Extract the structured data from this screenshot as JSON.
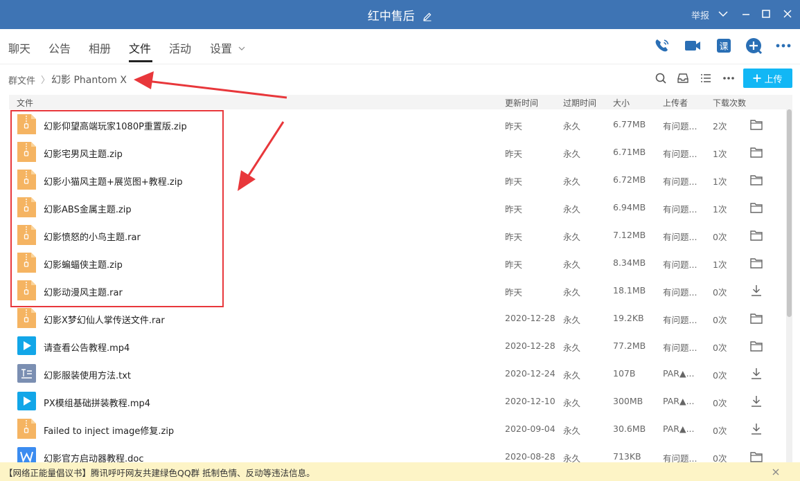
{
  "window": {
    "title": "红中售后",
    "report": "举报"
  },
  "tabs": [
    {
      "label": "聊天"
    },
    {
      "label": "公告"
    },
    {
      "label": "相册"
    },
    {
      "label": "文件"
    },
    {
      "label": "活动"
    },
    {
      "label": "设置"
    }
  ],
  "toolbar_icons": [
    "phone-icon",
    "video-icon",
    "class-icon",
    "add-icon",
    "more-icon"
  ],
  "breadcrumb": {
    "root": "群文件",
    "separator": "〉",
    "current": "幻影 Phantom X"
  },
  "upload_button": {
    "label": "上传"
  },
  "columns": {
    "file": "文件",
    "updated": "更新时间",
    "expires": "过期时间",
    "size": "大小",
    "uploader": "上传者",
    "downloads": "下载次数"
  },
  "files": [
    {
      "name": "幻影仰望高端玩家1080P重置版.zip",
      "type": "zip",
      "updated": "昨天",
      "expires": "永久",
      "size": "6.77MB",
      "uploader": "有问题...",
      "downloads": "2次",
      "action": "folder"
    },
    {
      "name": "幻影宅男风主题.zip",
      "type": "zip",
      "updated": "昨天",
      "expires": "永久",
      "size": "6.71MB",
      "uploader": "有问题...",
      "downloads": "1次",
      "action": "folder"
    },
    {
      "name": "幻影小猫风主题+展览图+教程.zip",
      "type": "zip",
      "updated": "昨天",
      "expires": "永久",
      "size": "6.72MB",
      "uploader": "有问题...",
      "downloads": "1次",
      "action": "folder"
    },
    {
      "name": "幻影ABS金属主题.zip",
      "type": "zip",
      "updated": "昨天",
      "expires": "永久",
      "size": "6.94MB",
      "uploader": "有问题...",
      "downloads": "1次",
      "action": "folder"
    },
    {
      "name": "幻影愤怒的小鸟主题.rar",
      "type": "zip",
      "updated": "昨天",
      "expires": "永久",
      "size": "7.12MB",
      "uploader": "有问题...",
      "downloads": "0次",
      "action": "folder"
    },
    {
      "name": "幻影蝙蝠侠主题.zip",
      "type": "zip",
      "updated": "昨天",
      "expires": "永久",
      "size": "8.34MB",
      "uploader": "有问题...",
      "downloads": "1次",
      "action": "folder"
    },
    {
      "name": "幻影动漫风主题.rar",
      "type": "zip",
      "updated": "昨天",
      "expires": "永久",
      "size": "18.1MB",
      "uploader": "有问题...",
      "downloads": "0次",
      "action": "download"
    },
    {
      "name": "幻影X梦幻仙人掌传送文件.rar",
      "type": "zip",
      "updated": "2020-12-28",
      "expires": "永久",
      "size": "19.2KB",
      "uploader": "有问题...",
      "downloads": "0次",
      "action": "folder"
    },
    {
      "name": "请查看公告教程.mp4",
      "type": "video",
      "updated": "2020-12-28",
      "expires": "永久",
      "size": "77.2MB",
      "uploader": "有问题...",
      "downloads": "0次",
      "action": "folder"
    },
    {
      "name": "幻影服装使用方法.txt",
      "type": "txt",
      "updated": "2020-12-24",
      "expires": "永久",
      "size": "107B",
      "uploader": "PAR▲...",
      "downloads": "0次",
      "action": "download"
    },
    {
      "name": "PX模组基础拼装教程.mp4",
      "type": "video",
      "updated": "2020-12-10",
      "expires": "永久",
      "size": "300MB",
      "uploader": "PAR▲...",
      "downloads": "0次",
      "action": "download"
    },
    {
      "name": "Failed to inject image修复.zip",
      "type": "zip",
      "updated": "2020-09-04",
      "expires": "永久",
      "size": "30.6MB",
      "uploader": "PAR▲...",
      "downloads": "0次",
      "action": "download"
    },
    {
      "name": "幻影官方启动器教程.doc",
      "type": "doc",
      "updated": "2020-08-28",
      "expires": "永久",
      "size": "713KB",
      "uploader": "有问题...",
      "downloads": "0次",
      "action": "folder"
    }
  ],
  "notice": {
    "text": "【网络正能量倡议书】腾讯呼吁网友共建绿色QQ群 抵制色情、反动等违法信息。"
  },
  "colors": {
    "titlebar": "#3e74b4",
    "accent": "#12b7f5",
    "annotation_red": "#e8373b",
    "zip_icon": "#f5b462",
    "video_icon": "#12a6e8",
    "txt_icon": "#7b8fb2",
    "doc_icon": "#3b8cf0"
  }
}
